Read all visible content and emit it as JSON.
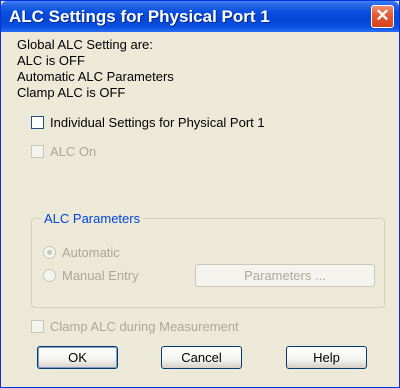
{
  "window": {
    "title": "ALC Settings for Physical Port 1",
    "close_glyph": "✕"
  },
  "info": {
    "line1": "Global ALC Setting are:",
    "line2": "ALC is OFF",
    "line3": "Automatic ALC Parameters",
    "line4": "Clamp ALC is OFF"
  },
  "options": {
    "individual_settings": {
      "label": "Individual Settings for Physical Port 1",
      "checked": false,
      "enabled": true
    },
    "alc_on": {
      "label": "ALC On",
      "checked": false,
      "enabled": false
    },
    "clamp_alc": {
      "label": "Clamp ALC during Measurement",
      "checked": false,
      "enabled": false
    }
  },
  "alc_parameters": {
    "title": "ALC Parameters",
    "automatic": {
      "label": "Automatic",
      "selected": true,
      "enabled": false
    },
    "manual_entry": {
      "label": "Manual Entry",
      "selected": false,
      "enabled": false
    },
    "parameters_button": "Parameters ..."
  },
  "buttons": {
    "ok": "OK",
    "cancel": "Cancel",
    "help": "Help"
  },
  "colors": {
    "title_bar": "#0a4fe0",
    "dialog_bg": "#ece9d8",
    "group_title": "#0046d5",
    "disabled_text": "#aca899",
    "close_button": "#e35a33"
  }
}
